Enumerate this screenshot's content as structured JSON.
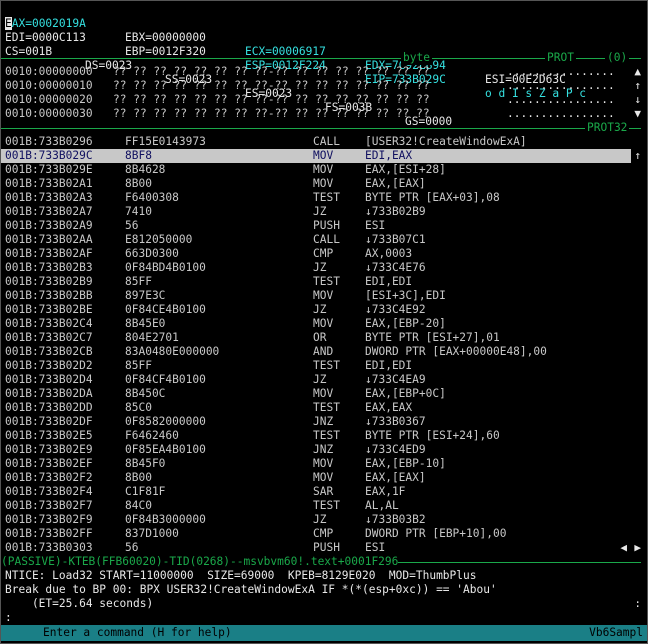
{
  "registers": {
    "row1": {
      "eax": "EAX=0002019A",
      "ebx": "EBX=00000000",
      "ecx": "ECX=00006917",
      "edx": "EDX=7C92EB94",
      "esi": "ESI=00E2D63C"
    },
    "row2": {
      "edi": "EDI=0000C113",
      "ebp": "EBP=0012F320",
      "esp": "ESP=0012F224",
      "eip": "EIP=733B029C",
      "flags": "o d I s Z a P c"
    },
    "row3": {
      "cs": "CS=001B",
      "ds": "DS=0023",
      "ss": "SS=0023",
      "es": "ES=0023",
      "fs": "FS=003B",
      "gs": "GS=0000"
    }
  },
  "data_window": {
    "sep_label_byte": "byte",
    "sep_label_prot": "PROT",
    "sep_label_num": "(0)",
    "rows": [
      {
        "addr": "0010:00000000",
        "bytes": "?? ?? ?? ?? ?? ?? ?? ??-?? ?? ?? ?? ?? ?? ?? ??",
        "ascii": "................"
      },
      {
        "addr": "0010:00000010",
        "bytes": "?? ?? ?? ?? ?? ?? ?? ??-?? ?? ?? ?? ?? ?? ?? ??",
        "ascii": "................"
      },
      {
        "addr": "0010:00000020",
        "bytes": "?? ?? ?? ?? ?? ?? ?? ??-?? ?? ?? ?? ?? ?? ?? ??",
        "ascii": "................"
      },
      {
        "addr": "0010:00000030",
        "bytes": "?? ?? ?? ?? ?? ?? ?? ??-?? ?? ?? ?? ?? ?? ?? ??",
        "ascii": "................"
      }
    ]
  },
  "code_window": {
    "sep_label": "PROT32",
    "rows": [
      {
        "addr": "001B:733B0296",
        "hex": "FF15E0143973",
        "mn": "CALL",
        "op": "[USER32!CreateWindowExA]"
      },
      {
        "addr": "001B:733B029C",
        "hex": "8BF8",
        "mn": "MOV",
        "op": "EDI,EAX"
      },
      {
        "addr": "001B:733B029E",
        "hex": "8B4628",
        "mn": "MOV",
        "op": "EAX,[ESI+28]"
      },
      {
        "addr": "001B:733B02A1",
        "hex": "8B00",
        "mn": "MOV",
        "op": "EAX,[EAX]"
      },
      {
        "addr": "001B:733B02A3",
        "hex": "F6400308",
        "mn": "TEST",
        "op": "BYTE PTR [EAX+03],08"
      },
      {
        "addr": "001B:733B02A7",
        "hex": "7410",
        "mn": "JZ",
        "op": "↓733B02B9"
      },
      {
        "addr": "001B:733B02A9",
        "hex": "56",
        "mn": "PUSH",
        "op": "ESI"
      },
      {
        "addr": "001B:733B02AA",
        "hex": "E812050000",
        "mn": "CALL",
        "op": "↓733B07C1"
      },
      {
        "addr": "001B:733B02AF",
        "hex": "663D0300",
        "mn": "CMP",
        "op": "AX,0003"
      },
      {
        "addr": "001B:733B02B3",
        "hex": "0F84BD4B0100",
        "mn": "JZ",
        "op": "↓733C4E76"
      },
      {
        "addr": "001B:733B02B9",
        "hex": "85FF",
        "mn": "TEST",
        "op": "EDI,EDI"
      },
      {
        "addr": "001B:733B02BB",
        "hex": "897E3C",
        "mn": "MOV",
        "op": "[ESI+3C],EDI"
      },
      {
        "addr": "001B:733B02BE",
        "hex": "0F84CE4B0100",
        "mn": "JZ",
        "op": "↓733C4E92"
      },
      {
        "addr": "001B:733B02C4",
        "hex": "8B45E0",
        "mn": "MOV",
        "op": "EAX,[EBP-20]"
      },
      {
        "addr": "001B:733B02C7",
        "hex": "804E2701",
        "mn": "OR",
        "op": "BYTE PTR [ESI+27],01"
      },
      {
        "addr": "001B:733B02CB",
        "hex": "83A0480E000000",
        "mn": "AND",
        "op": "DWORD PTR [EAX+00000E48],00"
      },
      {
        "addr": "001B:733B02D2",
        "hex": "85FF",
        "mn": "TEST",
        "op": "EDI,EDI"
      },
      {
        "addr": "001B:733B02D4",
        "hex": "0F84CF4B0100",
        "mn": "JZ",
        "op": "↓733C4EA9"
      },
      {
        "addr": "001B:733B02DA",
        "hex": "8B450C",
        "mn": "MOV",
        "op": "EAX,[EBP+0C]"
      },
      {
        "addr": "001B:733B02DD",
        "hex": "85C0",
        "mn": "TEST",
        "op": "EAX,EAX"
      },
      {
        "addr": "001B:733B02DF",
        "hex": "0F8582000000",
        "mn": "JNZ",
        "op": "↓733B0367"
      },
      {
        "addr": "001B:733B02E5",
        "hex": "F6462460",
        "mn": "TEST",
        "op": "BYTE PTR [ESI+24],60"
      },
      {
        "addr": "001B:733B02E9",
        "hex": "0F85EA4B0100",
        "mn": "JNZ",
        "op": "↓733C4ED9"
      },
      {
        "addr": "001B:733B02EF",
        "hex": "8B45F0",
        "mn": "MOV",
        "op": "EAX,[EBP-10]"
      },
      {
        "addr": "001B:733B02F2",
        "hex": "8B00",
        "mn": "MOV",
        "op": "EAX,[EAX]"
      },
      {
        "addr": "001B:733B02F4",
        "hex": "C1F81F",
        "mn": "SAR",
        "op": "EAX,1F"
      },
      {
        "addr": "001B:733B02F7",
        "hex": "84C0",
        "mn": "TEST",
        "op": "AL,AL"
      },
      {
        "addr": "001B:733B02F9",
        "hex": "0F84B3000000",
        "mn": "JZ",
        "op": "↓733B03B2"
      },
      {
        "addr": "001B:733B02FF",
        "hex": "837D1000",
        "mn": "CMP",
        "op": "DWORD PTR [EBP+10],00"
      },
      {
        "addr": "001B:733B0303",
        "hex": "56",
        "mn": "PUSH",
        "op": "ESI"
      }
    ]
  },
  "status_sep": "(PASSIVE)-KTEB(FFB60020)-TID(0268)--msvbvm60!.text+0001F296",
  "log_lines": [
    "NTICE: Load32 START=11000000  SIZE=69000  KPEB=8129E020  MOD=ThumbPlus",
    "Break due to BP 00: BPX USER32!CreateWindowExA IF *(*(esp+0xc)) == 'Abou'",
    "    (ET=25.64 seconds)",
    ":"
  ],
  "command_bar": {
    "hint": "Enter a command (H for help)",
    "module": "Vb6Sampl"
  }
}
